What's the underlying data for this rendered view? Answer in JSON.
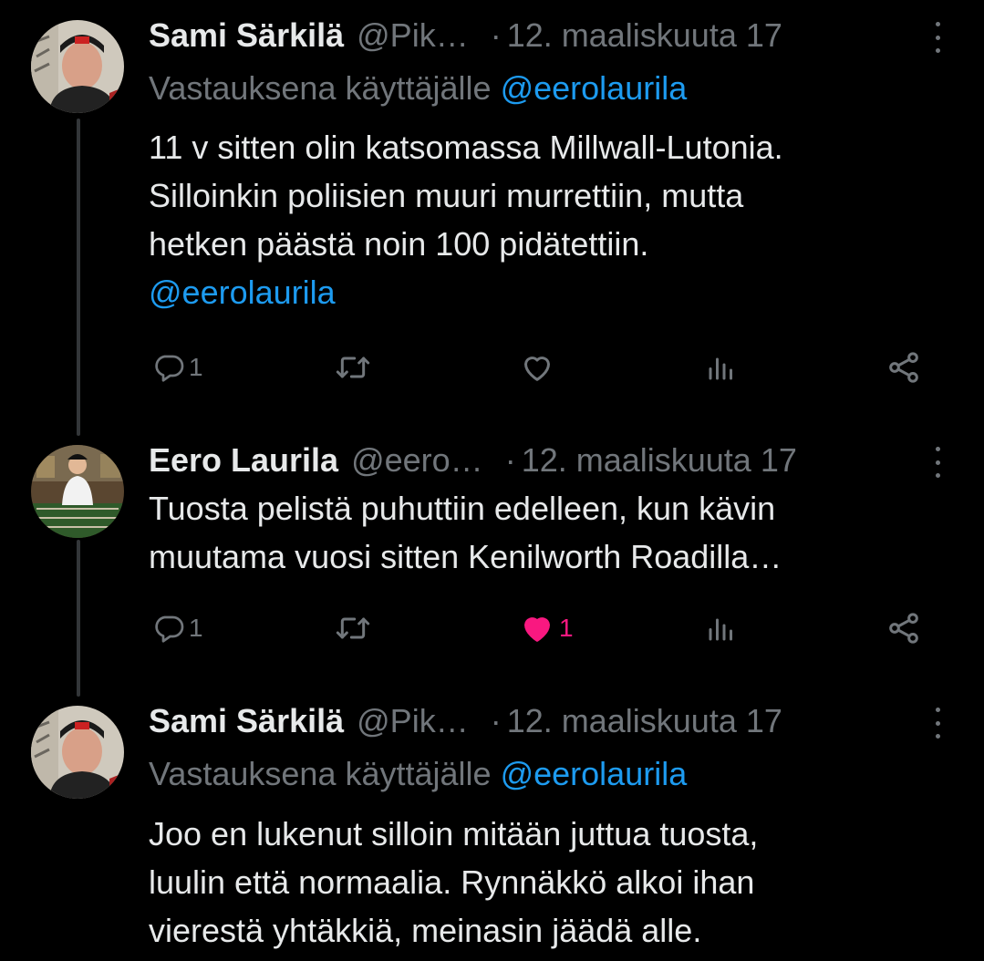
{
  "colors": {
    "background": "#000000",
    "text": "#e7e9ea",
    "muted": "#71767b",
    "link": "#1d9bf0",
    "like_active": "#f91880",
    "thread_line": "#333639"
  },
  "icons": {
    "reply": "reply-bubble-icon",
    "retweet": "retweet-icon",
    "like": "heart-icon",
    "views": "views-bar-chart-icon",
    "share": "share-icon",
    "more": "more-options-icon"
  },
  "tweets": [
    {
      "name": "Sami Särkilä",
      "handle": "@Pik…",
      "separator": "·",
      "date": "12. maaliskuuta 17",
      "reply_prefix": "Vastauksena käyttäjälle",
      "reply_mention": "@eerolaurila",
      "lines": [
        "11 v sitten olin katsomassa Millwall-Lutonia.",
        "Silloinkin poliisien muuri murrettiin, mutta",
        "hetken päästä noin 100 pidätettiin."
      ],
      "trailing_mention": "@eerolaurila",
      "reply_count": "1",
      "retweet_count": "",
      "like_count": "",
      "liked": false,
      "views_count": ""
    },
    {
      "name": "Eero Laurila",
      "handle": "@eero…",
      "separator": "·",
      "date": "12. maaliskuuta 17",
      "lines": [
        "Tuosta pelistä puhuttiin edelleen, kun kävin",
        "muutama vuosi sitten Kenilworth Roadilla…"
      ],
      "reply_count": "1",
      "retweet_count": "",
      "like_count": "1",
      "liked": true,
      "views_count": ""
    },
    {
      "name": "Sami Särkilä",
      "handle": "@Pik…",
      "separator": "·",
      "date": "12. maaliskuuta 17",
      "reply_prefix": "Vastauksena käyttäjälle",
      "reply_mention": "@eerolaurila",
      "lines": [
        "Joo en lukenut silloin mitään juttua tuosta,",
        "luulin että normaalia. Rynnäkkö alkoi ihan",
        "vierestä yhtäkkiä, meinasin jäädä alle."
      ]
    }
  ]
}
